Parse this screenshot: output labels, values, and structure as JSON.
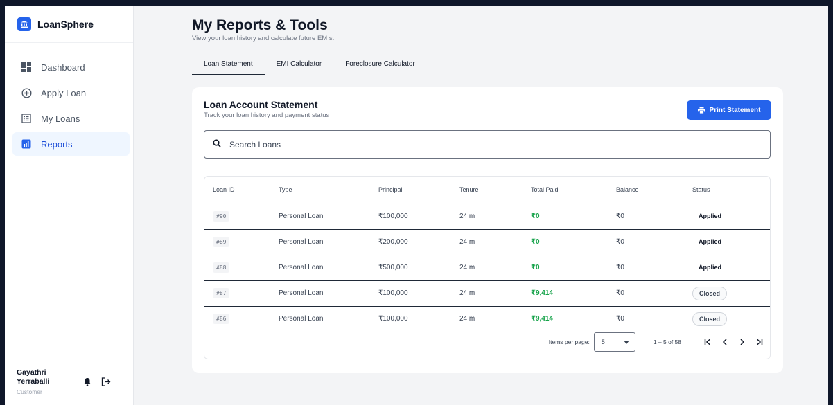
{
  "brand": {
    "name": "LoanSphere"
  },
  "sidebar": {
    "items": [
      {
        "label": "Dashboard",
        "icon": "dashboard-icon"
      },
      {
        "label": "Apply Loan",
        "icon": "plus-circle-icon"
      },
      {
        "label": "My Loans",
        "icon": "list-icon"
      },
      {
        "label": "Reports",
        "icon": "chart-icon",
        "active": true
      }
    ]
  },
  "user": {
    "name": "Gayathri Yerraballi",
    "role": "Customer"
  },
  "page": {
    "title": "My Reports & Tools",
    "subtitle": "View your loan history and calculate future EMIs."
  },
  "tabs": [
    "Loan Statement",
    "EMI Calculator",
    "Foreclosure Calculator"
  ],
  "card": {
    "title": "Loan Account Statement",
    "subtitle": "Track your loan history and payment status",
    "print_label": "Print Statement"
  },
  "search": {
    "placeholder": "Search Loans"
  },
  "table": {
    "headers": [
      "Loan ID",
      "Type",
      "Principal",
      "Tenure",
      "Total Paid",
      "Balance",
      "Status"
    ],
    "rows": [
      {
        "id": "#90",
        "type": "Personal Loan",
        "principal": "₹100,000",
        "tenure": "24 m",
        "paid": "₹0",
        "balance": "₹0",
        "status": "Applied"
      },
      {
        "id": "#89",
        "type": "Personal Loan",
        "principal": "₹200,000",
        "tenure": "24 m",
        "paid": "₹0",
        "balance": "₹0",
        "status": "Applied"
      },
      {
        "id": "#88",
        "type": "Personal Loan",
        "principal": "₹500,000",
        "tenure": "24 m",
        "paid": "₹0",
        "balance": "₹0",
        "status": "Applied"
      },
      {
        "id": "#87",
        "type": "Personal Loan",
        "principal": "₹100,000",
        "tenure": "24 m",
        "paid": "₹9,414",
        "balance": "₹0",
        "status": "Closed"
      },
      {
        "id": "#86",
        "type": "Personal Loan",
        "principal": "₹100,000",
        "tenure": "24 m",
        "paid": "₹9,414",
        "balance": "₹0",
        "status": "Closed"
      }
    ]
  },
  "pager": {
    "items_per_page_label": "Items per page:",
    "items_per_page": "5",
    "range": "1 – 5 of 58"
  },
  "colors": {
    "accent": "#2563eb",
    "paid": "#16a34a",
    "background": "#0f172a"
  }
}
